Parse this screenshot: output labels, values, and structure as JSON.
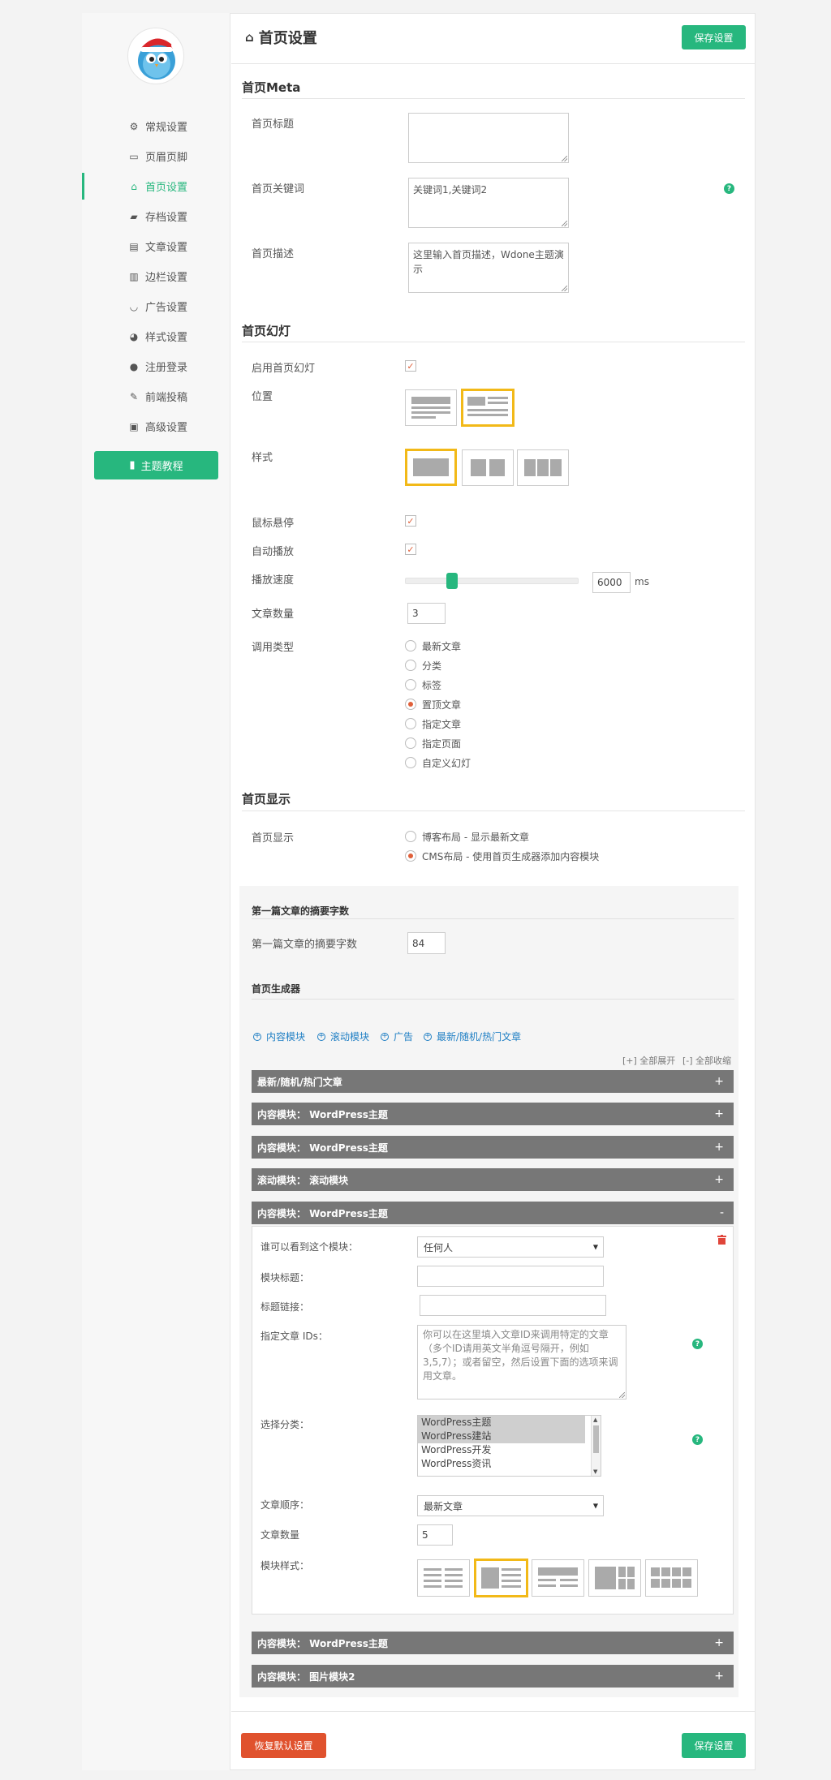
{
  "sidebar": {
    "items": [
      {
        "label": "常规设置",
        "icon": "gear-icon",
        "glyph": "⚙"
      },
      {
        "label": "页眉页脚",
        "icon": "header-icon",
        "glyph": "▭"
      },
      {
        "label": "首页设置",
        "icon": "home-icon",
        "glyph": "⌂",
        "active": true
      },
      {
        "label": "存档设置",
        "icon": "folder-icon",
        "glyph": "▰"
      },
      {
        "label": "文章设置",
        "icon": "article-icon",
        "glyph": "▤"
      },
      {
        "label": "边栏设置",
        "icon": "sidebar-icon",
        "glyph": "▥"
      },
      {
        "label": "广告设置",
        "icon": "smile-icon",
        "glyph": "◡"
      },
      {
        "label": "样式设置",
        "icon": "palette-icon",
        "glyph": "◕"
      },
      {
        "label": "注册登录",
        "icon": "user-icon",
        "glyph": "●"
      },
      {
        "label": "前端投稿",
        "icon": "pencil-icon",
        "glyph": "✎"
      },
      {
        "label": "高级设置",
        "icon": "advanced-icon",
        "glyph": "▣"
      }
    ],
    "tutorial_label": "主题教程",
    "tutorial_icon": "book-icon"
  },
  "header": {
    "title": "首页设置",
    "save_label": "保存设置"
  },
  "meta": {
    "section_title": "首页Meta",
    "title_label": "首页标题",
    "title_value": "",
    "keywords_label": "首页关键词",
    "keywords_value": "关键词1,关键词2",
    "desc_label": "首页描述",
    "desc_value": "这里输入首页描述，Wdone主题演示"
  },
  "slider": {
    "section_title": "首页幻灯",
    "enable_label": "启用首页幻灯",
    "position_label": "位置",
    "style_label": "样式",
    "hover_label": "鼠标悬停",
    "autoplay_label": "自动播放",
    "speed_label": "播放速度",
    "speed_value": "6000",
    "speed_unit": "ms",
    "speed_fraction": 0.27,
    "count_label": "文章数量",
    "count_value": "3",
    "type_label": "调用类型",
    "type_options": [
      "最新文章",
      "分类",
      "标签",
      "置顶文章",
      "指定文章",
      "指定页面",
      "自定义幻灯"
    ],
    "type_selected": 3
  },
  "display": {
    "section_title": "首页显示",
    "label": "首页显示",
    "options": [
      "博客布局 - 显示最新文章",
      "CMS布局 - 使用首页生成器添加内容模块"
    ],
    "selected": 1
  },
  "cms": {
    "excerpt_title": "第一篇文章的摘要字数",
    "excerpt_label": "第一篇文章的摘要字数",
    "excerpt_value": "84",
    "builder_title": "首页生成器",
    "add_links": [
      "内容模块",
      "滚动模块",
      "广告",
      "最新/随机/热门文章"
    ],
    "expand_all": "[+] 全部展开",
    "collapse_all": "[-] 全部收缩",
    "bars": [
      "最新/随机/热门文章",
      "内容模块： WordPress主题",
      "内容模块： WordPress主题",
      "滚动模块： 滚动模块",
      "内容模块： WordPress主题",
      "内容模块： WordPress主题",
      "内容模块： 图片模块2"
    ],
    "plus": "+",
    "minus": "-",
    "panel": {
      "visibility_label": "谁可以看到这个模块：",
      "visibility_value": "任何人",
      "title_label": "模块标题：",
      "link_label": "标题链接：",
      "ids_label": "指定文章 IDs：",
      "ids_placeholder": "你可以在这里填入文章ID来调用特定的文章（多个ID请用英文半角逗号隔开，例如3,5,7）；或者留空，然后设置下面的选项来调用文章。",
      "category_label": "选择分类：",
      "categories": [
        "WordPress主题",
        "WordPress建站",
        "WordPress开发",
        "WordPress资讯"
      ],
      "order_label": "文章顺序：",
      "order_value": "最新文章",
      "count_label": "文章数量",
      "count_value": "5",
      "style_label": "模块样式："
    }
  },
  "footer": {
    "reset_label": "恢复默认设置",
    "save_label": "保存设置"
  },
  "colors": {
    "accent": "#27b77e",
    "danger": "#e0522e",
    "highlight": "#f2b918"
  }
}
